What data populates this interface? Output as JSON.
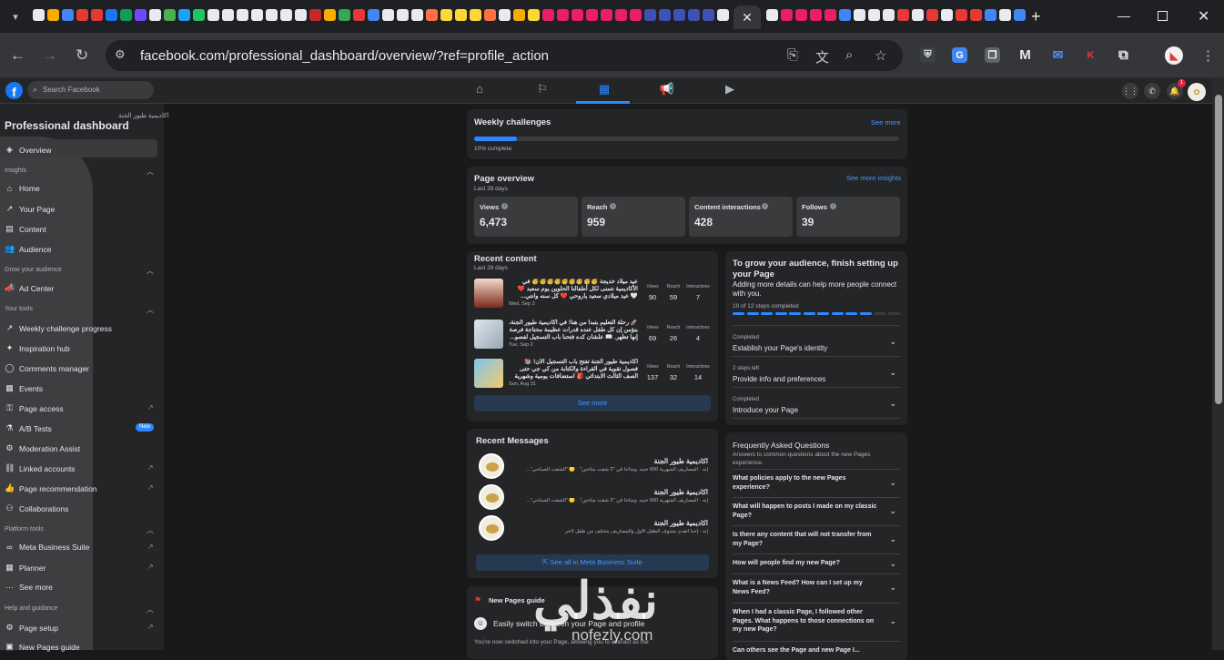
{
  "browser": {
    "url": "facebook.com/professional_dashboard/overview/?ref=profile_action",
    "tab_close": "✕",
    "new_tab": "+",
    "favicon_colors": [
      "#e8eaed",
      "#f9ab00",
      "#4285f4",
      "#e53935",
      "#e53935",
      "#1877f2",
      "#0f9d58",
      "#6d4aff",
      "#e8eaed",
      "#4caf50",
      "#1da1f2",
      "#22c55e",
      "#e8eaed",
      "#e8eaed",
      "#e8eaed",
      "#e8eaed",
      "#e8eaed",
      "#e8eaed",
      "#e8eaed",
      "#c62828",
      "#f9ab00",
      "#34a853",
      "#e53935",
      "#4285f4",
      "#e8eaed",
      "#e8eaed",
      "#e8eaed",
      "#ff7043",
      "#fdd835",
      "#fdd835",
      "#fdd835",
      "#ff7043",
      "#e8eaed",
      "#f9ab00",
      "#fdd835",
      "#e91e63",
      "#e91e63",
      "#e91e63",
      "#e91e63",
      "#e91e63",
      "#e91e63",
      "#e91e63",
      "#3f51b5",
      "#3f51b5",
      "#3f51b5",
      "#3f51b5",
      "#3f51b5",
      "#e8eaed"
    ],
    "favicon_colors_right": [
      "#e8eaed",
      "#e91e63",
      "#e91e63",
      "#e91e63",
      "#e91e63",
      "#4285f4",
      "#e8eaed",
      "#e8eaed",
      "#e8eaed",
      "#e53935",
      "#e8eaed",
      "#e53935",
      "#e8eaed",
      "#e53935",
      "#e53935",
      "#4285f4",
      "#e8eaed",
      "#4285f4"
    ]
  },
  "fb": {
    "search_placeholder": "Search Facebook",
    "notif_count": "1"
  },
  "sidebar": {
    "page_name": "اكاديمية طيور الجنة",
    "title": "Professional dashboard",
    "overview": "Overview",
    "sections": {
      "insights": "Insights",
      "grow": "Grow your audience",
      "tools": "Your tools",
      "platform": "Platform tools",
      "help": "Help and guidance"
    },
    "items": {
      "home": "Home",
      "your_page": "Your Page",
      "content": "Content",
      "audience": "Audience",
      "ad_center": "Ad Center",
      "weekly": "Weekly challenge progress",
      "inspiration": "Inspiration hub",
      "comments": "Comments manager",
      "events": "Events",
      "page_access": "Page access",
      "ab": "A/B Tests",
      "moderation": "Moderation Assist",
      "linked": "Linked accounts",
      "recommendation": "Page recommendation",
      "collab": "Collaborations",
      "mbs": "Meta Business Suite",
      "planner": "Planner",
      "see_more": "See more",
      "page_setup": "Page setup",
      "new_guide": "New Pages guide"
    },
    "new_badge": "New"
  },
  "weekly": {
    "title": "Weekly challenges",
    "see_more": "See more",
    "progress_label": "10% complete",
    "progress": 0.1
  },
  "overview": {
    "title": "Page overview",
    "period": "Last 28 days",
    "link": "See more insights",
    "stats": [
      {
        "label": "Views",
        "value": "6,473"
      },
      {
        "label": "Reach",
        "value": "959"
      },
      {
        "label": "Content interactions",
        "value": "428"
      },
      {
        "label": "Follows",
        "value": "39"
      }
    ]
  },
  "recent": {
    "title": "Recent content",
    "period": "Last 28 days",
    "col_views": "Views",
    "col_reach": "Reach",
    "col_inter": "Interactions",
    "posts": [
      {
        "text": "عيد ميلاد خديجة 🥳🥳🥳🥳🥳🥳🥳🥳🥳 في الأكاديمية نتمنى لكل أطفالنا الحلوين يوم سعيد ❤️ 🤍 عيد ميلادي سعيد ياروحي ❤️ كل سنه وانتي...",
        "date": "Wed, Sep 3",
        "views": "90",
        "reach": "59",
        "interactions": "7"
      },
      {
        "text": "🚀 رحلة التعليم بتبدأ من هنا! في أكاديمية طيور الجنة، بنؤمن إن كل طفل عنده قدرات عظيمة محتاجة فرصة إنها تظهر. 📖 علشان كده فتحنا باب التسجيل لفصو...",
        "date": "Tue, Sep 2",
        "views": "69",
        "reach": "26",
        "interactions": "4"
      },
      {
        "text": "اكاديمية طيور الجنة تفتح باب التسجيل الآن! 📚 فصول تقوية في القراءة والكتابة من كي جي حتى الصف الثالث الابتدائي 🎒 استضافات يومية وشهرية بعد...",
        "date": "Sun, Aug 31",
        "views": "137",
        "reach": "32",
        "interactions": "14"
      }
    ],
    "see_more": "See more"
  },
  "messages": {
    "title": "Recent Messages",
    "items": [
      {
        "name": "اكاديمية طيور الجنة",
        "preview": "إنه · المصاريف الشهرية 600 جنيه. ومتاحا في \"2 شفت متاحين\" · 🟡 \"الشفت الصباحي\"..."
      },
      {
        "name": "اكاديمية طيور الجنة",
        "preview": "إنه · المصاريف الشهرية 600 جنيه. ومتاحا في \"2 شفت متاحين\" · 🟡 \"الشفت الصباحي\"..."
      },
      {
        "name": "اكاديمية طيور الجنة",
        "preview": "إنه · إحنا اتقدم بتشوف الطفل الأول والمصاريف بتختلف من طفل لاخر"
      }
    ],
    "see_all": "See all in Meta Business Suite"
  },
  "guide": {
    "title": "New Pages guide",
    "subtitle": "Easily switch between your Page and profile",
    "body": "You're now switched into your Page, allowing you to interact as the"
  },
  "setup": {
    "title": "To grow your audience, finish setting up your Page",
    "desc": "Adding more details can help more people connect with you.",
    "steps_label": "10 of 12 steps completed",
    "steps_done": 10,
    "steps_total": 12,
    "rows": [
      {
        "status": "Completed",
        "title": "Establish your Page's identity"
      },
      {
        "status": "2 steps left",
        "title": "Provide info and preferences"
      },
      {
        "status": "Completed",
        "title": "Introduce your Page"
      }
    ]
  },
  "faq": {
    "title": "Frequently Asked Questions",
    "desc": "Answers to common questions about the new Pages experience.",
    "questions": [
      "What policies apply to the new Pages experience?",
      "What will happen to posts I made on my classic Page?",
      "Is there any content that will not transfer from my Page?",
      "How will people find my new Page?",
      "What is a News Feed? How can I set up my News Feed?",
      "When I had a classic Page, I followed other Pages. What happens to those connections on my new Page?",
      "Can others see the Page and new Page I..."
    ]
  },
  "watermark": {
    "text": "نفذلي",
    "sub": "nofezly.com"
  }
}
